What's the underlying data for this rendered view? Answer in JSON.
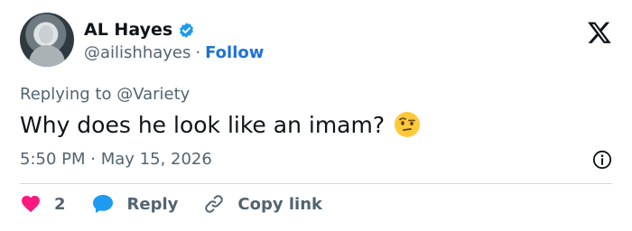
{
  "author": {
    "name": "AL Hayes",
    "handle": "@ailishhayes",
    "separator": "·",
    "follow_label": "Follow"
  },
  "tweet": {
    "replying_to": "Replying to @Variety",
    "text": "Why does he look like an imam?",
    "time": "5:50 PM",
    "time_separator": "·",
    "date": "May 15, 2026"
  },
  "actions": {
    "like_count": "2",
    "reply_label": "Reply",
    "copy_label": "Copy link"
  },
  "colors": {
    "accent": "#1d9bf0",
    "like": "#f91880",
    "text": "#0f1419",
    "secondary": "#536471"
  },
  "icons": [
    "verified-badge-icon",
    "x-logo-icon",
    "raised-eyebrow-emoji-icon",
    "info-icon",
    "heart-icon",
    "reply-bubble-icon",
    "link-icon"
  ]
}
